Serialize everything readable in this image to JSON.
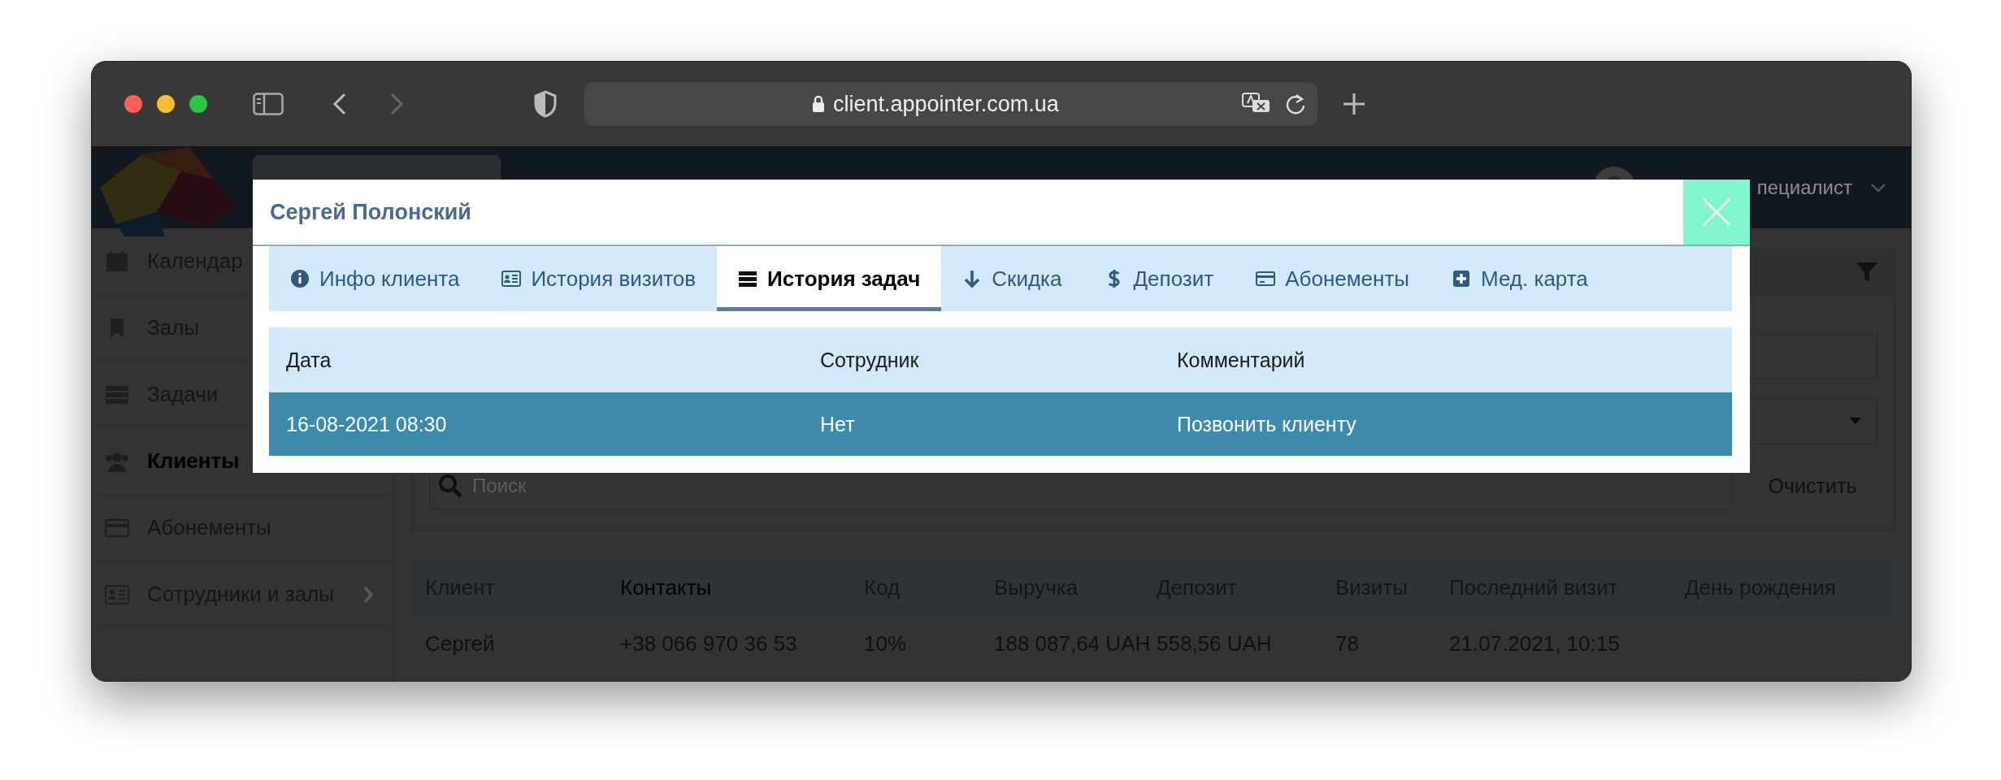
{
  "browser": {
    "url": "client.appointer.com.ua"
  },
  "header": {
    "role_label": "пециалист"
  },
  "sidebar": {
    "items": [
      {
        "label": "Календар",
        "selected": false,
        "kind": "link"
      },
      {
        "label": "Залы",
        "selected": false,
        "kind": "link"
      },
      {
        "label": "Задачи",
        "selected": false,
        "kind": "link"
      },
      {
        "label": "Клиенты",
        "selected": true,
        "kind": "link"
      },
      {
        "label": "Абонементы",
        "selected": false,
        "kind": "link"
      },
      {
        "label": "Сотрудники и залы",
        "selected": false,
        "kind": "group"
      }
    ]
  },
  "filters": {
    "search": {
      "placeholder": "Поиск"
    },
    "clear_button": "Очистить"
  },
  "clients_table": {
    "columns": [
      {
        "label": "Клиент",
        "sorted": false
      },
      {
        "label": "Контакты",
        "sorted": true
      },
      {
        "label": "Код",
        "sorted": false
      },
      {
        "label": "Выручка",
        "sorted": false
      },
      {
        "label": "Депозит",
        "sorted": false
      },
      {
        "label": "Визиты",
        "sorted": false
      },
      {
        "label": "Последний визит",
        "sorted": false
      },
      {
        "label": "День рождения",
        "sorted": false
      }
    ],
    "rows": [
      {
        "cells": [
          "Сергей",
          "+38 066 970 36 53",
          "10%",
          "188 087,64 UAH",
          "558,56 UAH",
          "78",
          "21.07.2021, 10:15"
        ]
      }
    ]
  },
  "modal": {
    "title": "Сергей Полонский",
    "tabs": [
      {
        "label": "Инфо клиента",
        "selected": false
      },
      {
        "label": "История визитов",
        "selected": false
      },
      {
        "label": "История задач",
        "selected": true
      },
      {
        "label": "Скидка",
        "selected": false
      },
      {
        "label": "Депозит",
        "selected": false
      },
      {
        "label": "Абонементы",
        "selected": false
      },
      {
        "label": "Мед. карта",
        "selected": false
      }
    ],
    "table": {
      "columns": [
        "Дата",
        "Сотрудник",
        "Комментарий"
      ],
      "rows": [
        {
          "cells": [
            "16-08-2021 08:30",
            "Нет",
            "Позвонить клиенту"
          ],
          "selected": true
        }
      ]
    }
  }
}
